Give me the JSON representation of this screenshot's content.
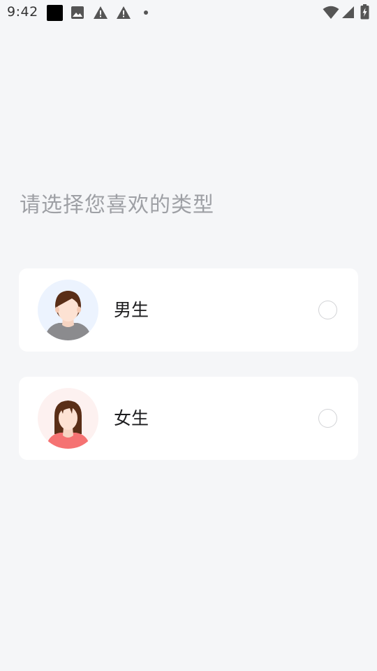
{
  "status_bar": {
    "time": "9:42"
  },
  "page": {
    "prompt": "请选择您喜欢的类型"
  },
  "options": [
    {
      "label": "男生",
      "avatar_bg": "#ecf3fe",
      "selected": false
    },
    {
      "label": "女生",
      "avatar_bg": "#fdf1f0",
      "selected": false
    }
  ],
  "colors": {
    "background": "#f5f6f8",
    "card": "#ffffff",
    "prompt_text": "#9ea0a5",
    "label_text": "#1d1d1f",
    "radio_border": "#d2d3d6"
  }
}
